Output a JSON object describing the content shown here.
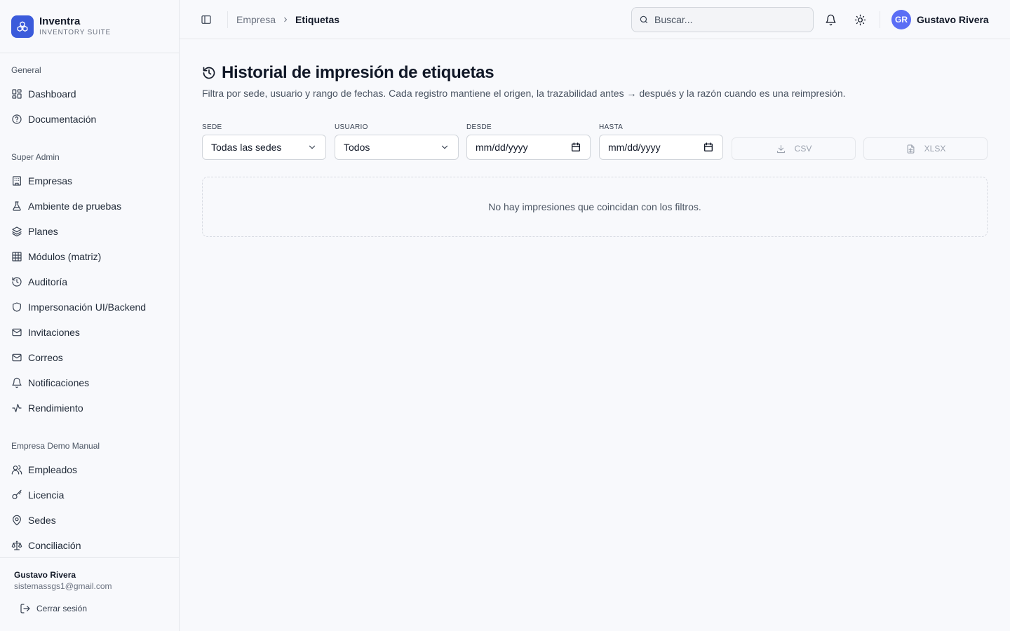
{
  "brand": {
    "name": "Inventra",
    "subtitle": "INVENTORY SUITE",
    "logo_icon": "cubes-icon",
    "color": "#3b5bdb"
  },
  "sidebar": {
    "groups": [
      {
        "label": "General",
        "items": [
          {
            "label": "Dashboard",
            "icon": "layout-grid-icon"
          },
          {
            "label": "Documentación",
            "icon": "help-circle-icon"
          }
        ]
      },
      {
        "label": "Super Admin",
        "items": [
          {
            "label": "Empresas",
            "icon": "building-icon"
          },
          {
            "label": "Ambiente de pruebas",
            "icon": "flask-icon"
          },
          {
            "label": "Planes",
            "icon": "layers-icon"
          },
          {
            "label": "Módulos (matriz)",
            "icon": "table-icon"
          },
          {
            "label": "Auditoría",
            "icon": "history-icon"
          },
          {
            "label": "Impersonación UI/Backend",
            "icon": "shield-icon"
          },
          {
            "label": "Invitaciones",
            "icon": "mail-icon"
          },
          {
            "label": "Correos",
            "icon": "mail-icon"
          },
          {
            "label": "Notificaciones",
            "icon": "bell-icon"
          },
          {
            "label": "Rendimiento",
            "icon": "activity-icon"
          }
        ]
      },
      {
        "label": "Empresa Demo Manual",
        "items": [
          {
            "label": "Empleados",
            "icon": "users-icon"
          },
          {
            "label": "Licencia",
            "icon": "key-icon"
          },
          {
            "label": "Sedes",
            "icon": "map-pin-icon"
          },
          {
            "label": "Conciliación",
            "icon": "scale-icon"
          }
        ]
      }
    ],
    "footer": {
      "name": "Gustavo Rivera",
      "email": "sistemassgs1@gmail.com",
      "logout_label": "Cerrar sesión"
    }
  },
  "topbar": {
    "breadcrumb": [
      "Empresa",
      "Etiquetas"
    ],
    "search_placeholder": "Buscar...",
    "user": {
      "initials": "GR",
      "name": "Gustavo Rivera",
      "avatar_color": "#5b6ef5"
    }
  },
  "main": {
    "title": "Historial de impresión de etiquetas",
    "subtitle": "Filtra por sede, usuario y rango de fechas. Cada registro mantiene el origen, la trazabilidad antes → después y la razón cuando es una reimpresión.",
    "filters": {
      "sede": {
        "label": "SEDE",
        "value": "Todas las sedes"
      },
      "usuario": {
        "label": "USUARIO",
        "value": "Todos"
      },
      "desde": {
        "label": "DESDE",
        "value": "mm/dd/yyyy"
      },
      "hasta": {
        "label": "HASTA",
        "value": "mm/dd/yyyy"
      }
    },
    "export": {
      "csv_label": "CSV",
      "xlsx_label": "XLSX"
    },
    "empty_message": "No hay impresiones que coincidan con los filtros."
  }
}
